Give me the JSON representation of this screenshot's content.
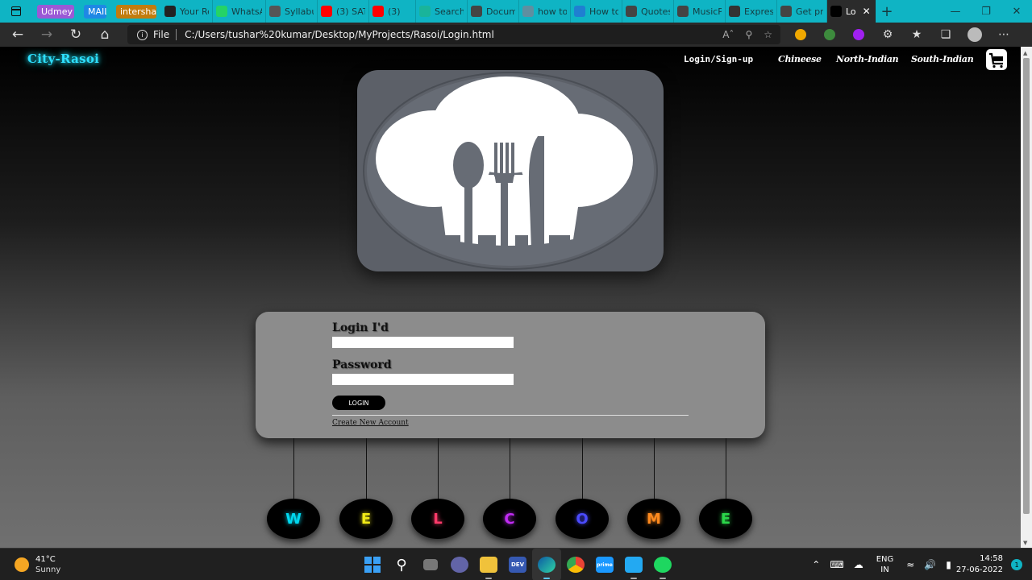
{
  "browser": {
    "tabs": [
      {
        "label": "Udmey",
        "kind": "badge",
        "color": "#9b59d6"
      },
      {
        "label": "MAIL",
        "kind": "badge",
        "color": "#1e88e5"
      },
      {
        "label": "intershala",
        "kind": "badge",
        "color": "#c27c0e"
      },
      {
        "label": "Your Re",
        "icon": "github-icon",
        "color": "#222"
      },
      {
        "label": "WhatsA",
        "icon": "whatsapp-icon",
        "color": "#25d366"
      },
      {
        "label": "Syllabu",
        "icon": "doc-icon",
        "color": "#555"
      },
      {
        "label": "(3) SAT",
        "icon": "youtube-icon",
        "color": "#ff0000"
      },
      {
        "label": "(3)",
        "icon": "youtube-icon",
        "color": "#ff0000"
      },
      {
        "label": "Search",
        "icon": "search-icon",
        "color": "#19b49b"
      },
      {
        "label": "Docum",
        "icon": "page-icon",
        "color": "#444"
      },
      {
        "label": "how to",
        "icon": "search-icon",
        "color": "#5f8fa0"
      },
      {
        "label": "How to",
        "icon": "p-icon",
        "color": "#1f7fd1"
      },
      {
        "label": "Quotes",
        "icon": "page-icon",
        "color": "#444"
      },
      {
        "label": "MusicP",
        "icon": "page-icon",
        "color": "#444"
      },
      {
        "label": "Expres",
        "icon": "film-icon",
        "color": "#333"
      },
      {
        "label": "Get pre",
        "icon": "page-icon",
        "color": "#444"
      },
      {
        "label": "Lo",
        "icon": "cr-icon",
        "color": "#000",
        "active": true
      }
    ],
    "new_tab": "+",
    "window_controls": [
      "—",
      "❐",
      "✕"
    ],
    "address": {
      "protocol": "File",
      "url": "C:/Users/tushar%20kumar/Desktop/MyProjects/Rasoi/Login.html"
    }
  },
  "site": {
    "brand": "City-Rasoi",
    "nav": [
      {
        "label": "Login/Sign-up"
      },
      {
        "label": "Chineese"
      },
      {
        "label": "North-Indian"
      },
      {
        "label": "South-Indian"
      }
    ],
    "cart_icon": "cart-icon"
  },
  "login": {
    "id_label": "Login I'd",
    "id_value": "",
    "password_label": "Password",
    "password_value": "",
    "button": "LOGIN",
    "create_link": "Create New Account"
  },
  "welcome": [
    {
      "letter": "W",
      "color": "#00d8f0"
    },
    {
      "letter": "E",
      "color": "#f1ea17"
    },
    {
      "letter": "L",
      "color": "#ff3a6a"
    },
    {
      "letter": "C",
      "color": "#c22cf5"
    },
    {
      "letter": "O",
      "color": "#4b4bff"
    },
    {
      "letter": "M",
      "color": "#ff8a1e"
    },
    {
      "letter": "E",
      "color": "#2bd64a"
    }
  ],
  "taskbar": {
    "weather_temp": "41°C",
    "weather_desc": "Sunny",
    "lang_1": "ENG",
    "lang_2": "IN",
    "time": "14:58",
    "date": "27-06-2022",
    "notifications": "1"
  }
}
